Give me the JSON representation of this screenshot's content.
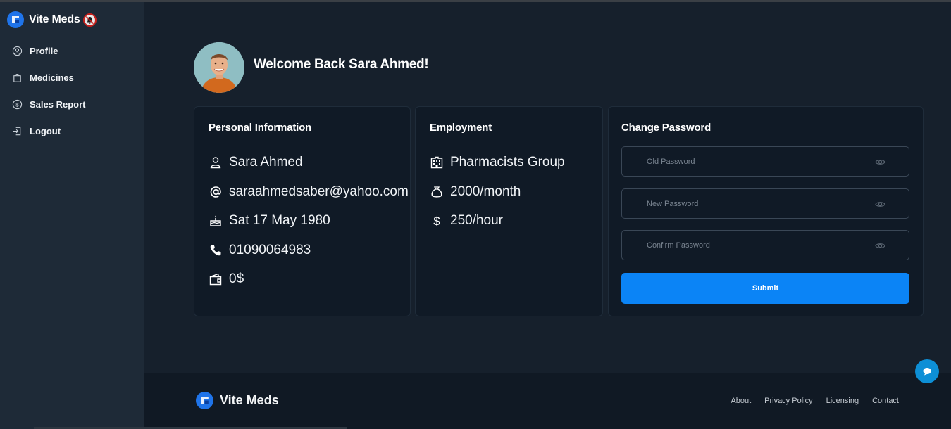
{
  "app": {
    "name": "Vite Meds"
  },
  "sidebar": {
    "items": [
      {
        "label": "Profile",
        "icon": "user-circle-icon"
      },
      {
        "label": "Medicines",
        "icon": "shopping-bag-icon"
      },
      {
        "label": "Sales Report",
        "icon": "dollar-circle-icon"
      },
      {
        "label": "Logout",
        "icon": "logout-icon"
      }
    ]
  },
  "profile": {
    "welcome": "Welcome Back Sara Ahmed!"
  },
  "personal": {
    "title": "Personal Information",
    "name": "Sara Ahmed",
    "email": "saraahmedsaber@yahoo.com",
    "birthdate": "Sat 17 May 1980",
    "phone": "01090064983",
    "wallet": "0$"
  },
  "employment": {
    "title": "Employment",
    "company": "Pharmacists Group",
    "salary": "2000/month",
    "hourly": "250/hour"
  },
  "password": {
    "title": "Change Password",
    "old_placeholder": "Old Password",
    "new_placeholder": "New Password",
    "confirm_placeholder": "Confirm Password",
    "submit_label": "Submit"
  },
  "footer": {
    "brand": "Vite Meds",
    "links": [
      "About",
      "Privacy Policy",
      "Licensing",
      "Contact"
    ]
  },
  "colors": {
    "accent": "#0b84f6",
    "sidebar_bg": "#1e2a37",
    "main_bg": "#16202c",
    "card_bg": "#101a26",
    "logo_blue": "#1f74ea",
    "chat_button": "#0d8fd6"
  }
}
